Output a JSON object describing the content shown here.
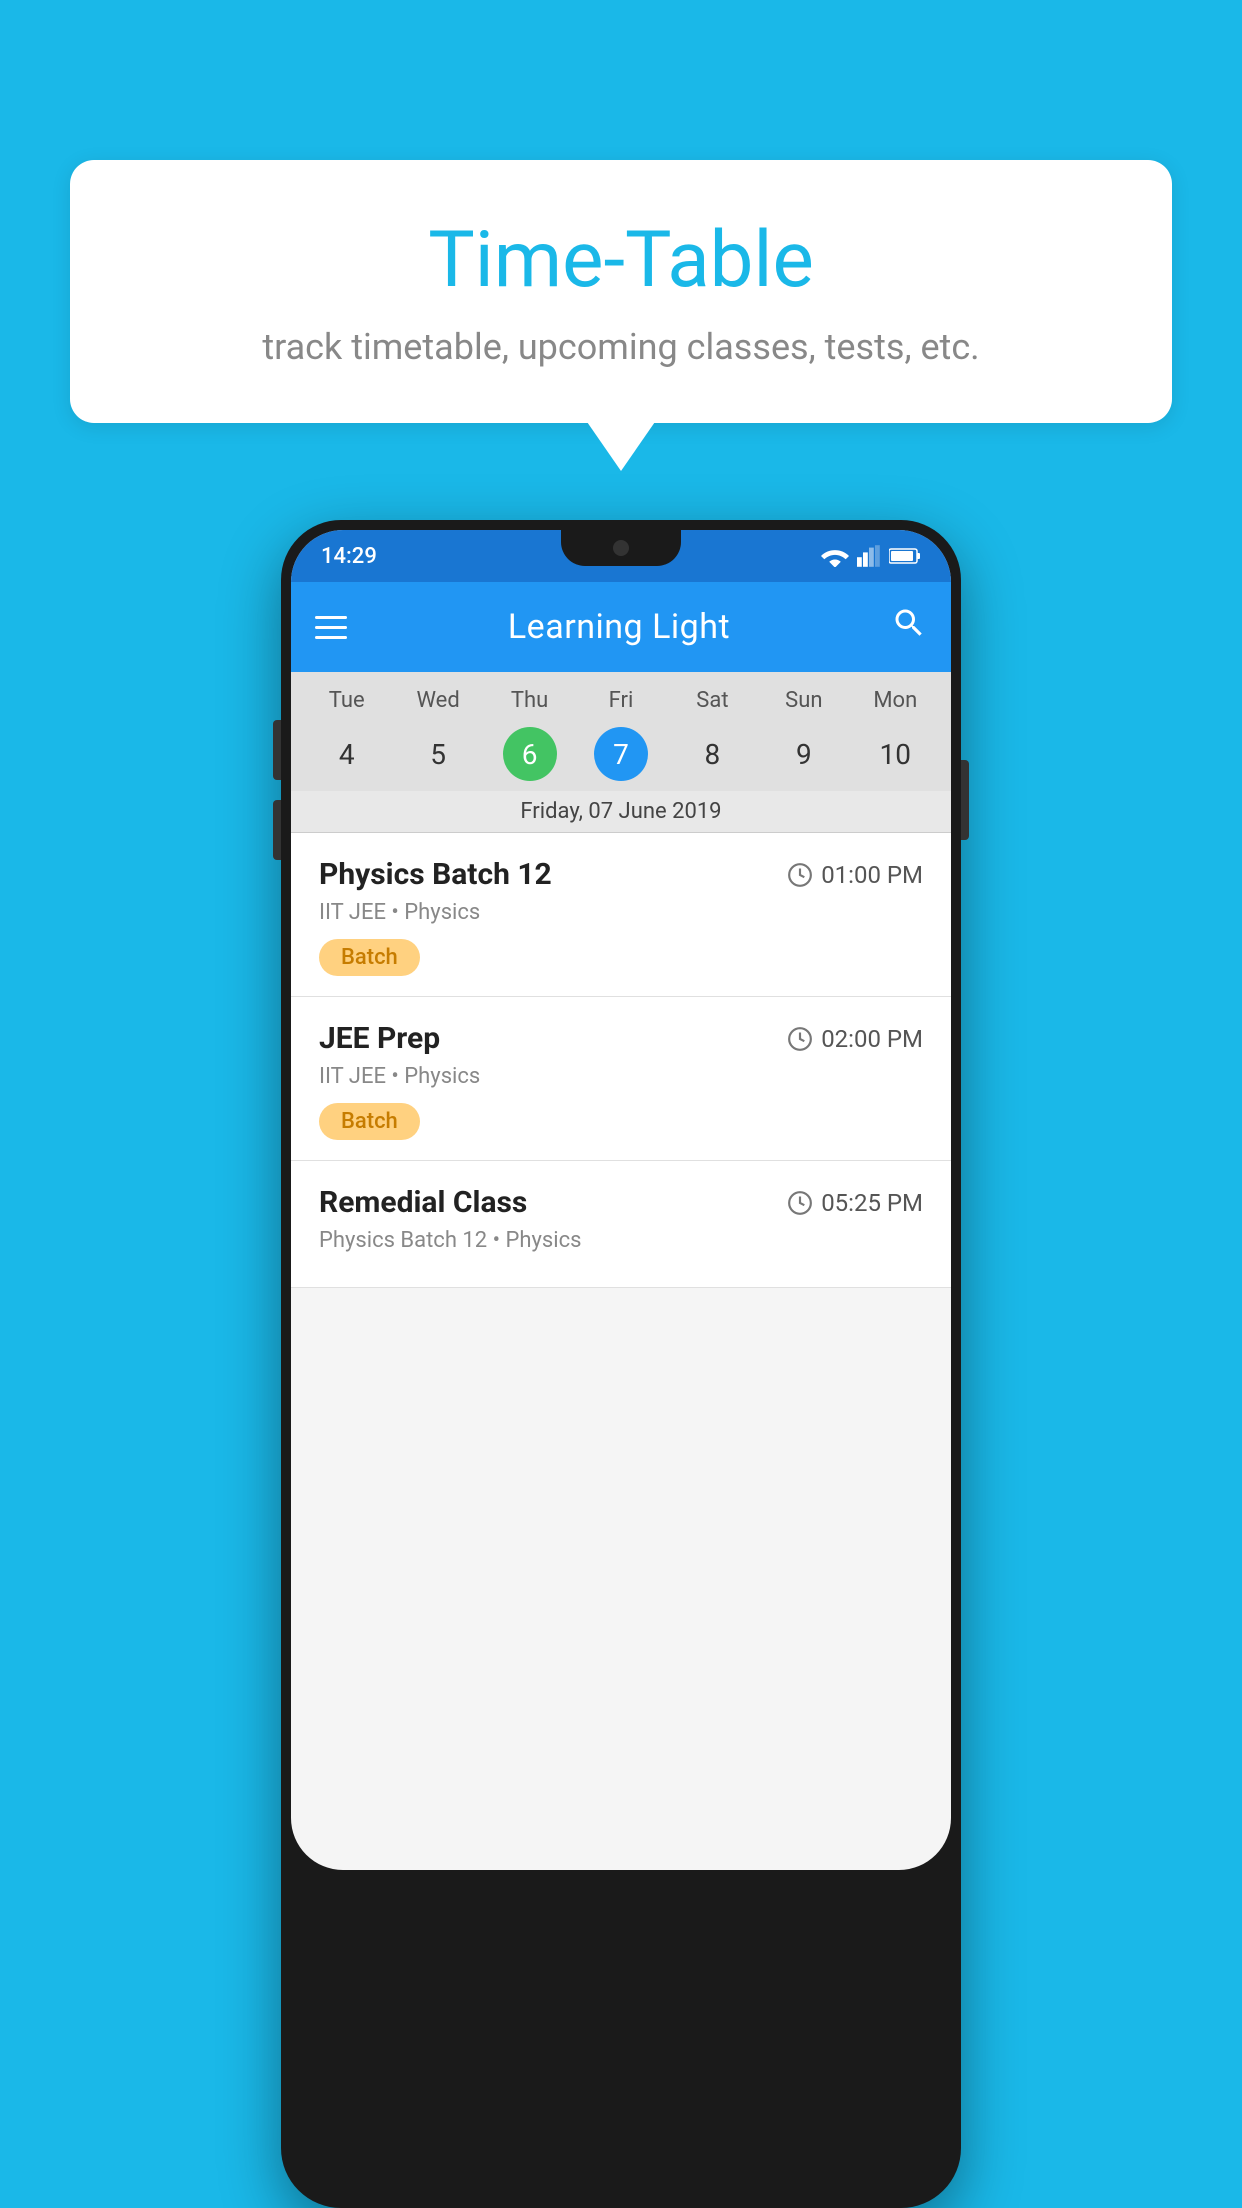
{
  "page": {
    "background_color": "#1ab8e8"
  },
  "bubble": {
    "title": "Time-Table",
    "subtitle": "track timetable, upcoming classes, tests, etc."
  },
  "phone": {
    "status_bar": {
      "time": "14:29"
    },
    "app_bar": {
      "title": "Learning Light"
    },
    "calendar": {
      "days": [
        {
          "name": "Tue",
          "num": "4",
          "style": "normal"
        },
        {
          "name": "Wed",
          "num": "5",
          "style": "normal"
        },
        {
          "name": "Thu",
          "num": "6",
          "style": "green"
        },
        {
          "name": "Fri",
          "num": "7",
          "style": "blue"
        },
        {
          "name": "Sat",
          "num": "8",
          "style": "normal"
        },
        {
          "name": "Sun",
          "num": "9",
          "style": "normal"
        },
        {
          "name": "Mon",
          "num": "10",
          "style": "normal"
        }
      ],
      "selected_date_label": "Friday, 07 June 2019"
    },
    "classes": [
      {
        "name": "Physics Batch 12",
        "time": "01:00 PM",
        "subtitle": "IIT JEE • Physics",
        "badge": "Batch"
      },
      {
        "name": "JEE Prep",
        "time": "02:00 PM",
        "subtitle": "IIT JEE • Physics",
        "badge": "Batch"
      },
      {
        "name": "Remedial Class",
        "time": "05:25 PM",
        "subtitle": "Physics Batch 12 • Physics",
        "badge": ""
      }
    ]
  }
}
